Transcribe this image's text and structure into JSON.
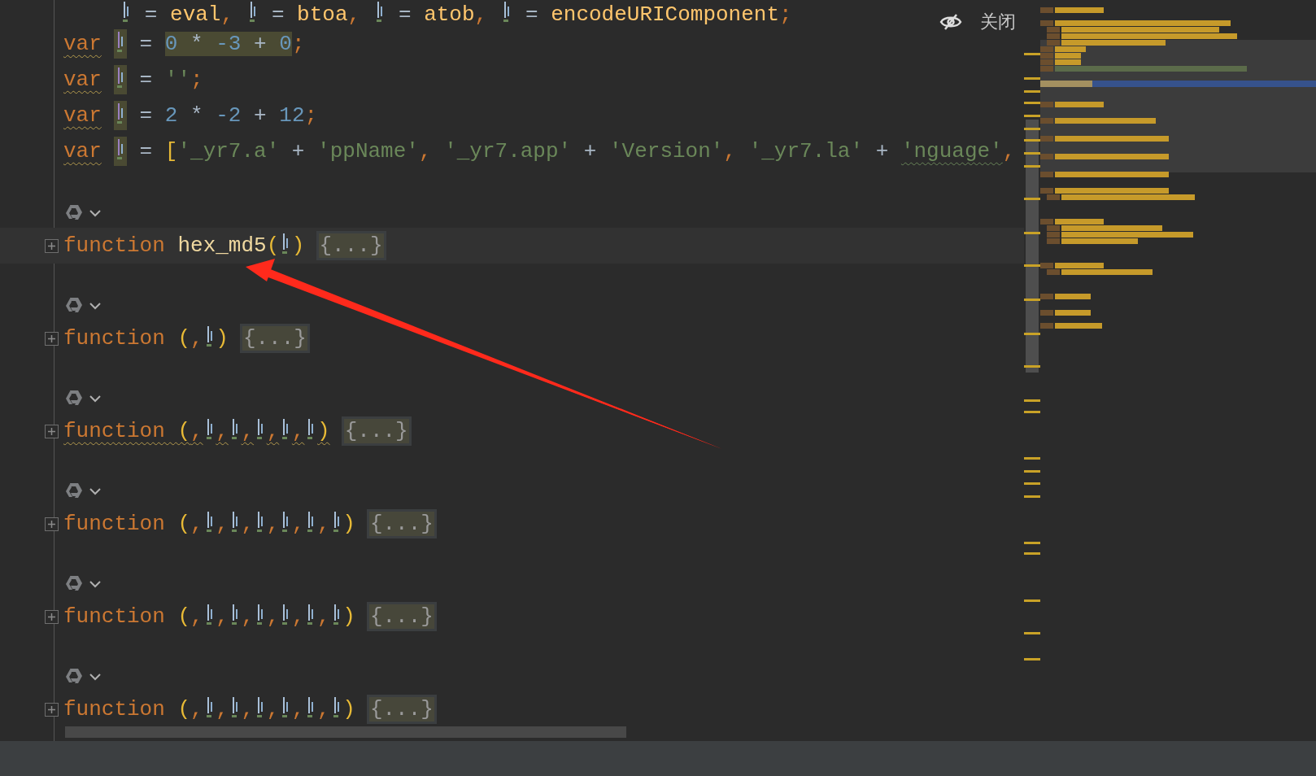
{
  "close_hint": {
    "label": "关闭"
  },
  "lines": [
    {
      "indented": true,
      "tokens": [
        {
          "kind": "mark",
          "highlighted": false
        },
        {
          "kind": "op",
          "text": " = "
        },
        {
          "kind": "ident",
          "text": "eval"
        },
        {
          "kind": "punct",
          "text": ", "
        },
        {
          "kind": "mark",
          "highlighted": false
        },
        {
          "kind": "op",
          "text": " = "
        },
        {
          "kind": "ident",
          "text": "btoa"
        },
        {
          "kind": "punct",
          "text": ", "
        },
        {
          "kind": "mark",
          "highlighted": false
        },
        {
          "kind": "op",
          "text": " = "
        },
        {
          "kind": "ident",
          "text": "atob"
        },
        {
          "kind": "punct",
          "text": ", "
        },
        {
          "kind": "mark",
          "highlighted": false
        },
        {
          "kind": "op",
          "text": " = "
        },
        {
          "kind": "ident",
          "text": "encodeURIComponent"
        },
        {
          "kind": "punct",
          "text": ";"
        }
      ]
    },
    {
      "indented": false,
      "tokens": [
        {
          "kind": "keyword",
          "text": "var",
          "warning": true
        },
        {
          "kind": "mark",
          "highlighted": true
        },
        {
          "kind": "op",
          "text": " = "
        },
        {
          "kind": "number",
          "text": "0",
          "highlighted": true
        },
        {
          "kind": "op",
          "text": " * ",
          "highlighted": true
        },
        {
          "kind": "number",
          "text": "-3",
          "highlighted": true
        },
        {
          "kind": "op",
          "text": " + ",
          "highlighted": true
        },
        {
          "kind": "number",
          "text": "0",
          "highlighted": true
        },
        {
          "kind": "punct",
          "text": ";"
        }
      ]
    },
    {
      "indented": false,
      "tokens": [
        {
          "kind": "keyword",
          "text": "var",
          "warning": true
        },
        {
          "kind": "mark",
          "highlighted": true
        },
        {
          "kind": "op",
          "text": " = "
        },
        {
          "kind": "string",
          "text": "''"
        },
        {
          "kind": "punct",
          "text": ";"
        }
      ]
    },
    {
      "indented": false,
      "tokens": [
        {
          "kind": "keyword",
          "text": "var",
          "warning": true
        },
        {
          "kind": "mark",
          "highlighted": true
        },
        {
          "kind": "op",
          "text": " = "
        },
        {
          "kind": "number",
          "text": "2"
        },
        {
          "kind": "op",
          "text": " * "
        },
        {
          "kind": "number",
          "text": "-2"
        },
        {
          "kind": "op",
          "text": " + "
        },
        {
          "kind": "number",
          "text": "12"
        },
        {
          "kind": "punct",
          "text": ";"
        }
      ]
    },
    {
      "indented": false,
      "tokens": [
        {
          "kind": "keyword",
          "text": "var",
          "warning": true
        },
        {
          "kind": "mark",
          "highlighted": true
        },
        {
          "kind": "op",
          "text": " = "
        },
        {
          "kind": "bracket",
          "text": "["
        },
        {
          "kind": "string",
          "text": "'_yr7.a'"
        },
        {
          "kind": "op",
          "text": " + "
        },
        {
          "kind": "string",
          "text": "'ppName'"
        },
        {
          "kind": "punct",
          "text": ", "
        },
        {
          "kind": "string",
          "text": "'_yr7.app'"
        },
        {
          "kind": "op",
          "text": " + "
        },
        {
          "kind": "string",
          "text": "'Version'"
        },
        {
          "kind": "punct",
          "text": ", "
        },
        {
          "kind": "string",
          "text": "'_yr7.la'"
        },
        {
          "kind": "op",
          "text": " + "
        },
        {
          "kind": "string",
          "text": "'nguage'",
          "warning": true
        },
        {
          "kind": "punct",
          "text": ","
        }
      ]
    }
  ],
  "functions": [
    {
      "current_line": true,
      "warning": false,
      "fold_text": "{...}",
      "tokens": [
        {
          "kind": "keyword",
          "text": "function "
        },
        {
          "kind": "fname",
          "text": "hex_md5"
        },
        {
          "kind": "bracket",
          "text": "("
        },
        {
          "kind": "mark",
          "highlighted": false
        },
        {
          "kind": "bracket",
          "text": ")"
        }
      ]
    },
    {
      "current_line": false,
      "warning": false,
      "fold_text": "{...}",
      "tokens": [
        {
          "kind": "keyword",
          "text": "function "
        },
        {
          "kind": "bracket",
          "text": "("
        },
        {
          "kind": "punct",
          "text": ","
        },
        {
          "kind": "mark",
          "highlighted": false
        },
        {
          "kind": "bracket",
          "text": ")"
        }
      ]
    },
    {
      "current_line": false,
      "warning": true,
      "fold_text": "{...}",
      "tokens": [
        {
          "kind": "keyword",
          "text": "function "
        },
        {
          "kind": "bracket",
          "text": "("
        },
        {
          "kind": "punct",
          "text": ","
        },
        {
          "kind": "mark",
          "highlighted": false
        },
        {
          "kind": "punct",
          "text": ","
        },
        {
          "kind": "mark",
          "highlighted": false
        },
        {
          "kind": "punct",
          "text": ","
        },
        {
          "kind": "mark",
          "highlighted": false
        },
        {
          "kind": "punct",
          "text": ","
        },
        {
          "kind": "mark",
          "highlighted": false
        },
        {
          "kind": "punct",
          "text": ","
        },
        {
          "kind": "mark",
          "highlighted": false
        },
        {
          "kind": "bracket",
          "text": ")"
        }
      ]
    },
    {
      "current_line": false,
      "warning": false,
      "fold_text": "{...}",
      "tokens": [
        {
          "kind": "keyword",
          "text": "function "
        },
        {
          "kind": "bracket",
          "text": "("
        },
        {
          "kind": "punct",
          "text": ","
        },
        {
          "kind": "mark",
          "highlighted": false
        },
        {
          "kind": "punct",
          "text": ","
        },
        {
          "kind": "mark",
          "highlighted": false
        },
        {
          "kind": "punct",
          "text": ","
        },
        {
          "kind": "mark",
          "highlighted": false
        },
        {
          "kind": "punct",
          "text": ","
        },
        {
          "kind": "mark",
          "highlighted": false
        },
        {
          "kind": "punct",
          "text": ","
        },
        {
          "kind": "mark",
          "highlighted": false
        },
        {
          "kind": "punct",
          "text": ","
        },
        {
          "kind": "mark",
          "highlighted": false
        },
        {
          "kind": "bracket",
          "text": ")"
        }
      ]
    },
    {
      "current_line": false,
      "warning": false,
      "fold_text": "{...}",
      "tokens": [
        {
          "kind": "keyword",
          "text": "function "
        },
        {
          "kind": "bracket",
          "text": "("
        },
        {
          "kind": "punct",
          "text": ","
        },
        {
          "kind": "mark",
          "highlighted": false
        },
        {
          "kind": "punct",
          "text": ","
        },
        {
          "kind": "mark",
          "highlighted": false
        },
        {
          "kind": "punct",
          "text": ","
        },
        {
          "kind": "mark",
          "highlighted": false
        },
        {
          "kind": "punct",
          "text": ","
        },
        {
          "kind": "mark",
          "highlighted": false
        },
        {
          "kind": "punct",
          "text": ","
        },
        {
          "kind": "mark",
          "highlighted": false
        },
        {
          "kind": "punct",
          "text": ","
        },
        {
          "kind": "mark",
          "highlighted": false
        },
        {
          "kind": "bracket",
          "text": ")"
        }
      ]
    },
    {
      "current_line": false,
      "warning": false,
      "fold_text": "{...}",
      "tokens": [
        {
          "kind": "keyword",
          "text": "function "
        },
        {
          "kind": "bracket",
          "text": "("
        },
        {
          "kind": "punct",
          "text": ","
        },
        {
          "kind": "mark",
          "highlighted": false
        },
        {
          "kind": "punct",
          "text": ","
        },
        {
          "kind": "mark",
          "highlighted": false
        },
        {
          "kind": "punct",
          "text": ","
        },
        {
          "kind": "mark",
          "highlighted": false
        },
        {
          "kind": "punct",
          "text": ","
        },
        {
          "kind": "mark",
          "highlighted": false
        },
        {
          "kind": "punct",
          "text": ","
        },
        {
          "kind": "mark",
          "highlighted": false
        },
        {
          "kind": "punct",
          "text": ","
        },
        {
          "kind": "mark",
          "highlighted": false
        },
        {
          "kind": "bracket",
          "text": ")"
        }
      ]
    }
  ]
}
